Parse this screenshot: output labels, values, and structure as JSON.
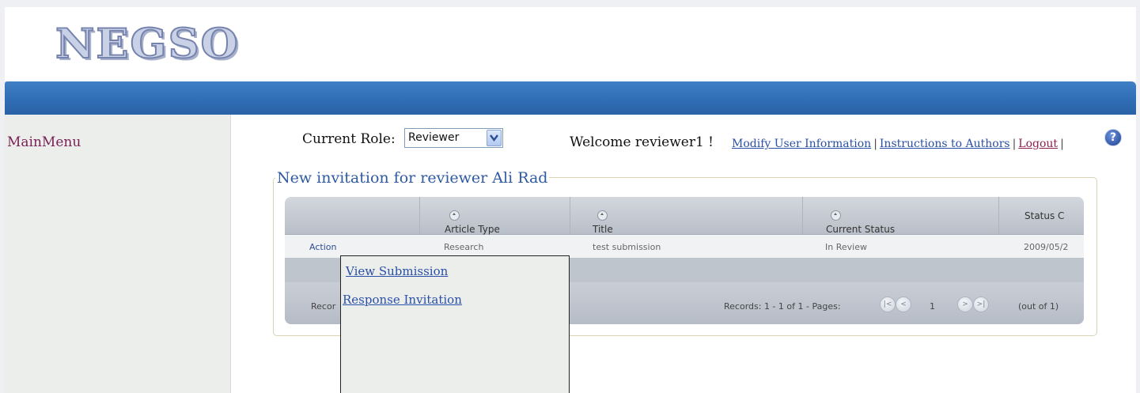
{
  "header": {
    "logo_text": "NEGSO"
  },
  "sidebar": {
    "main_menu_label": "MainMenu"
  },
  "toolbar": {
    "current_role_label": "Current Role:",
    "current_role_value": "Reviewer",
    "welcome_text": "Welcome reviewer1 !",
    "links": {
      "modify_user": "Modify User Information",
      "instructions": "Instructions to Authors",
      "logout": "Logout"
    },
    "separator": "|",
    "help_glyph": "?"
  },
  "invitation": {
    "legend": "New invitation for reviewer Ali Rad",
    "columns": [
      "Article Type",
      "Title",
      "Current Status",
      "Status C"
    ],
    "rows": [
      {
        "action": "Action",
        "article_type": "Research",
        "title": "test submission",
        "current_status": "In Review",
        "status_date": "2009/05/2"
      }
    ],
    "footer": {
      "left_text": "Recor",
      "records_text": "Records: 1 - 1 of 1 - Pages:",
      "page_number": "1",
      "out_of": "(out of 1)",
      "first_glyph": "|<",
      "prev_glyph": "<",
      "next_glyph": ">",
      "last_glyph": ">|"
    }
  },
  "action_menu": {
    "items": [
      "View Submission",
      "Response Invitation"
    ]
  },
  "colors": {
    "header_bar": "#2f6cb3",
    "link": "#2a4fa6",
    "logout_link": "#8b1f4f",
    "sidebar_link": "#7a1f55"
  },
  "icons": {
    "select_arrow": "chevron-down-icon",
    "help": "help-icon",
    "sort": "sort-icon"
  }
}
